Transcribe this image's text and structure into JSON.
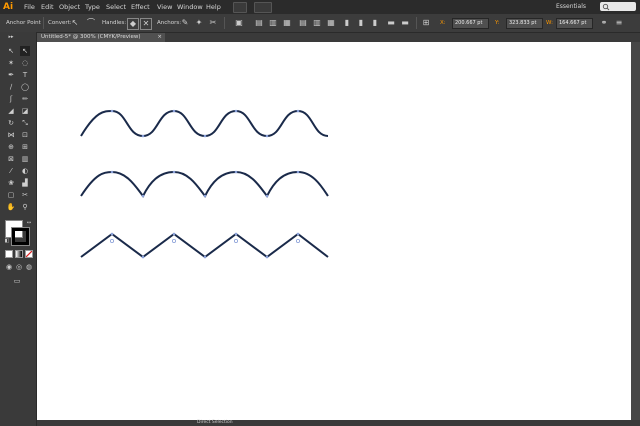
{
  "app": {
    "logo": "Ai"
  },
  "menu": [
    "File",
    "Edit",
    "Object",
    "Type",
    "Select",
    "Effect",
    "View",
    "Window",
    "Help"
  ],
  "workspace": {
    "label": "Essentials"
  },
  "control": {
    "anchor_point_label": "Anchor Point",
    "convert_label": "Convert:",
    "handles_label": "Handles:",
    "anchors_label": "Anchors:",
    "x_value": "200.667 pt",
    "y_value": "323.833 pt",
    "w_value": "164.667 pt"
  },
  "document": {
    "tab_title": "Untitled-5* @ 300% (CMYK/Preview)",
    "close_symbol": "×"
  },
  "status": {
    "text": "Direct Selection"
  },
  "colors": {
    "path_stroke": "#1a2a4a",
    "anchor": "#8aa0d8",
    "accent": "#ff9a00"
  },
  "icons": {
    "search": "search-icon"
  }
}
